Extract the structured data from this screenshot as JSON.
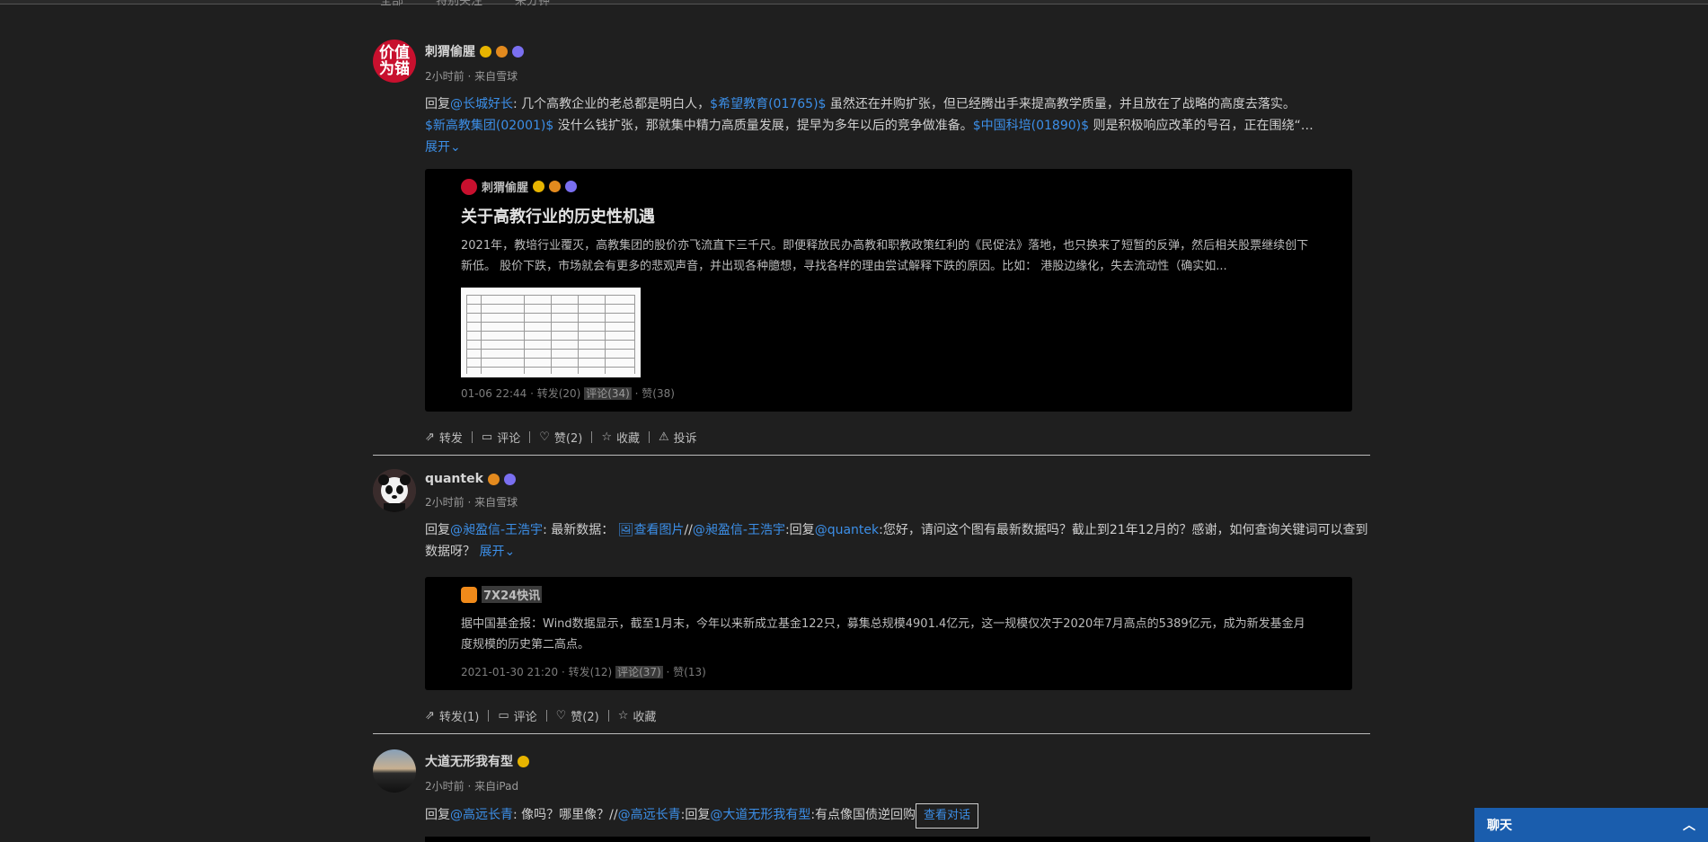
{
  "top_tabs": [
    "全部",
    "特别关注",
    "来分钟"
  ],
  "posts": [
    {
      "avatar_text": "价值为锚",
      "username": "刺猬偷腥",
      "meta": "2小时前 · 来自雪球",
      "text_segments": [
        {
          "t": "回复",
          "link": false
        },
        {
          "t": "@长城好长",
          "link": true
        },
        {
          "t": ": 几个高教企业的老总都是明白人，",
          "link": false
        },
        {
          "t": "$希望教育(01765)$",
          "link": true
        },
        {
          "t": " 虽然还在并购扩张，但已经腾出手来提高教学质量，并且放在了战略的高度去落实。",
          "link": false
        },
        {
          "t": "$新高教集团(02001)$",
          "link": true
        },
        {
          "t": " 没什么钱扩张，那就集中精力高质量发展，提早为多年以后的竞争做准备。",
          "link": false
        },
        {
          "t": "$中国科培(01890)$",
          "link": true
        },
        {
          "t": " 则是积极响应改革的号召，正在围绕“…",
          "link": false
        }
      ],
      "expand_label": "展开",
      "card": {
        "author": "刺猬偷腥",
        "title": "关于高教行业的历史性机遇",
        "text": "2021年，教培行业覆灭，高教集团的股价亦飞流直下三千尺。即便释放民办高教和职教政策红利的《民促法》落地，也只换来了短暂的反弹，然后相关股票继续创下新低。 股价下跌，市场就会有更多的悲观声音，并出现各种臆想，寻找各样的理由尝试解释下跌的原因。比如： 港股边缘化，失去流动性（确实如...",
        "date": "01-06 22:44",
        "repost": "转发(20)",
        "comment": "评论(34)",
        "like": "赞(38)"
      },
      "actions": [
        "转发",
        "评论",
        "赞(2)",
        "收藏",
        "投诉"
      ]
    },
    {
      "username": "quantek",
      "meta": "2小时前 · 来自雪球",
      "text_segments": [
        {
          "t": "回复",
          "link": false
        },
        {
          "t": "@昶盈信-王浩宇",
          "link": true
        },
        {
          "t": ": 最新数据： ",
          "link": false
        },
        {
          "t": "🖼查看图片",
          "link": true
        },
        {
          "t": "//",
          "link": false
        },
        {
          "t": "@昶盈信-王浩宇",
          "link": true
        },
        {
          "t": ":回复",
          "link": false
        },
        {
          "t": "@quantek",
          "link": true
        },
        {
          "t": ":您好，请问这个图有最新数据吗？截止到21年12月的？感谢，如何查询关键词可以查到数据呀？",
          "link": false
        }
      ],
      "expand_label": "展开",
      "card": {
        "author": "7X24快讯",
        "text": "据中国基金报：Wind数据显示，截至1月末，今年以来新成立基金122只，募集总规模4901.4亿元，这一规模仅次于2020年7月高点的5389亿元，成为新发基金月度规模的历史第二高点。",
        "date": "2021-01-30 21:20",
        "repost": "转发(12)",
        "comment": "评论(37)",
        "like": "赞(13)"
      },
      "actions": [
        "转发(1)",
        "评论",
        "赞(2)",
        "收藏"
      ]
    },
    {
      "username": "大道无形我有型",
      "meta": "2小时前 · 来自iPad",
      "text_segments": [
        {
          "t": "回复",
          "link": false
        },
        {
          "t": "@高远长青",
          "link": true
        },
        {
          "t": ": 像吗？哪里像？//",
          "link": false
        },
        {
          "t": "@高远长青",
          "link": true
        },
        {
          "t": ":回复",
          "link": false
        },
        {
          "t": "@大道无形我有型",
          "link": true
        },
        {
          "t": ":有点像国债逆回购",
          "link": false
        }
      ],
      "view_conversation": "查看对话"
    }
  ],
  "chat": {
    "label": "聊天"
  }
}
